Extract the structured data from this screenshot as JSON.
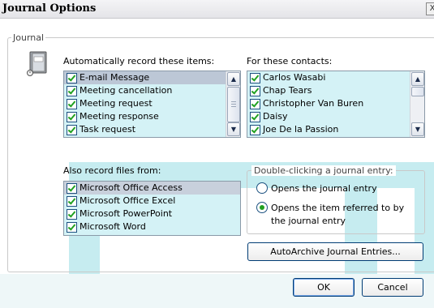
{
  "window": {
    "title": "Journal Options",
    "close_glyph": "X"
  },
  "journal_group": {
    "legend": "Journal"
  },
  "record_items": {
    "label": "Automatically record these items:",
    "items": [
      {
        "label": "E-mail Message",
        "checked": true,
        "selected": true
      },
      {
        "label": "Meeting cancellation",
        "checked": true
      },
      {
        "label": "Meeting request",
        "checked": true
      },
      {
        "label": "Meeting response",
        "checked": true
      },
      {
        "label": "Task request",
        "checked": true
      }
    ]
  },
  "contacts": {
    "label": "For these contacts:",
    "items": [
      {
        "label": "Carlos Wasabi",
        "checked": true
      },
      {
        "label": "Chap Tears",
        "checked": true
      },
      {
        "label": "Christopher Van Buren",
        "checked": true
      },
      {
        "label": "Daisy",
        "checked": true
      },
      {
        "label": "Joe De la Passion",
        "checked": true
      }
    ]
  },
  "record_files": {
    "label": "Also record files from:",
    "items": [
      {
        "label": "Microsoft Office Access",
        "checked": true,
        "selected": true
      },
      {
        "label": "Microsoft Office Excel",
        "checked": true
      },
      {
        "label": "Microsoft PowerPoint",
        "checked": true
      },
      {
        "label": "Microsoft Word",
        "checked": true
      }
    ]
  },
  "double_click": {
    "legend": "Double-clicking a journal entry:",
    "options": [
      {
        "label": "Opens the journal entry",
        "selected": false
      },
      {
        "label_line1": "Opens the item referred to by",
        "label_line2": "the journal entry",
        "selected": true
      }
    ]
  },
  "buttons": {
    "autoarchive": "AutoArchive Journal Entries...",
    "ok": "OK",
    "cancel": "Cancel"
  },
  "icons": {
    "journal": "journal-book-icon",
    "scroll_up": "scroll-up-arrow-icon",
    "scroll_down": "scroll-down-arrow-icon",
    "check": "checkmark-icon"
  },
  "colors": {
    "list_background": "#d4f2f6",
    "selection": "#bcc7d6",
    "check_green": "#21a121",
    "decor_teal": "#c6ecf0"
  }
}
